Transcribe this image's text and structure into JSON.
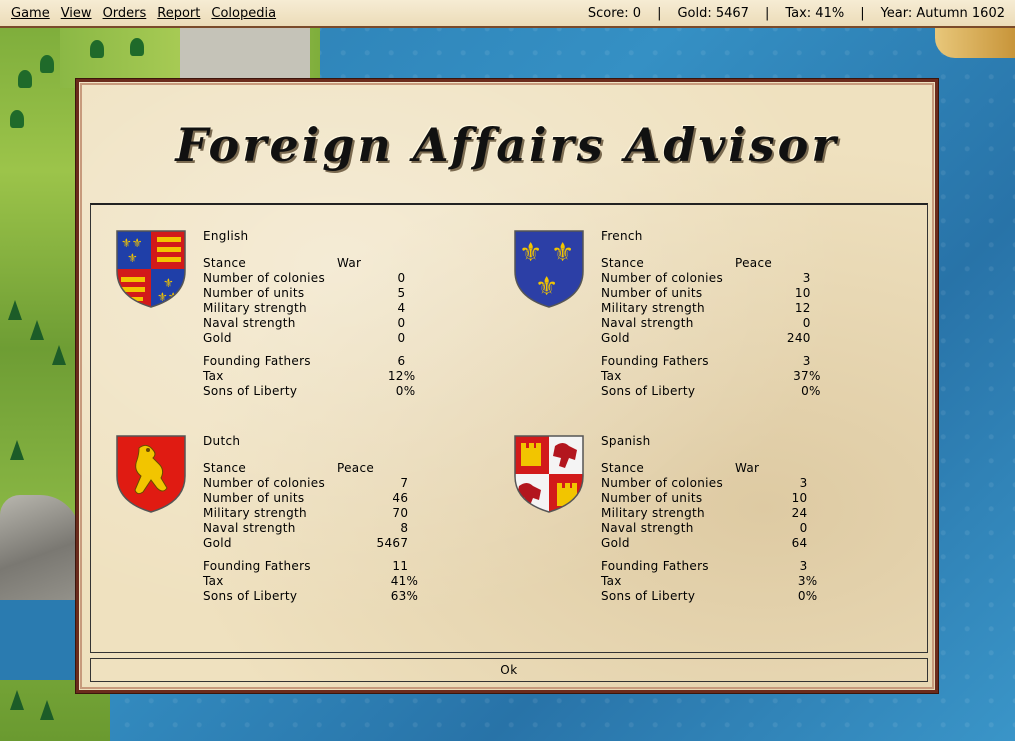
{
  "menu": [
    "Game",
    "View",
    "Orders",
    "Report",
    "Colopedia"
  ],
  "status": {
    "score": "Score: 0",
    "gold": "Gold: 5467",
    "tax": "Tax: 41%",
    "year": "Year: Autumn 1602",
    "separator": "|"
  },
  "dialog": {
    "title": "Foreign Affairs Advisor",
    "ok_label": "Ok"
  },
  "labels": {
    "stance": "Stance",
    "colonies": "Number of colonies",
    "units": "Number of units",
    "military": "Military strength",
    "naval": "Naval strength",
    "gold": "Gold",
    "fathers": "Founding Fathers",
    "tax": "Tax",
    "sol": "Sons of Liberty"
  },
  "nations": [
    {
      "name": "English",
      "stance": "War",
      "colonies": "0",
      "units": "5",
      "military": "4",
      "naval": "0",
      "gold": "0",
      "fathers": "6",
      "tax": "12%",
      "sol": "0%",
      "crest": "england-coat-of-arms"
    },
    {
      "name": "French",
      "stance": "Peace",
      "colonies": "3",
      "units": "10",
      "military": "12",
      "naval": "0",
      "gold": "240",
      "fathers": "3",
      "tax": "37%",
      "sol": "0%",
      "crest": "france-fleur-de-lis"
    },
    {
      "name": "Dutch",
      "stance": "Peace",
      "colonies": "7",
      "units": "46",
      "military": "70",
      "naval": "8",
      "gold": "5467",
      "fathers": "11",
      "tax": "41%",
      "sol": "63%",
      "crest": "netherlands-lion"
    },
    {
      "name": "Spanish",
      "stance": "War",
      "colonies": "3",
      "units": "10",
      "military": "24",
      "naval": "0",
      "gold": "64",
      "fathers": "3",
      "tax": "3%",
      "sol": "0%",
      "crest": "spain-castile-leon"
    }
  ],
  "colors": {
    "parchment": "#efe1bf",
    "frame": "#6b2b1c",
    "sea": "#2f7fb0"
  }
}
